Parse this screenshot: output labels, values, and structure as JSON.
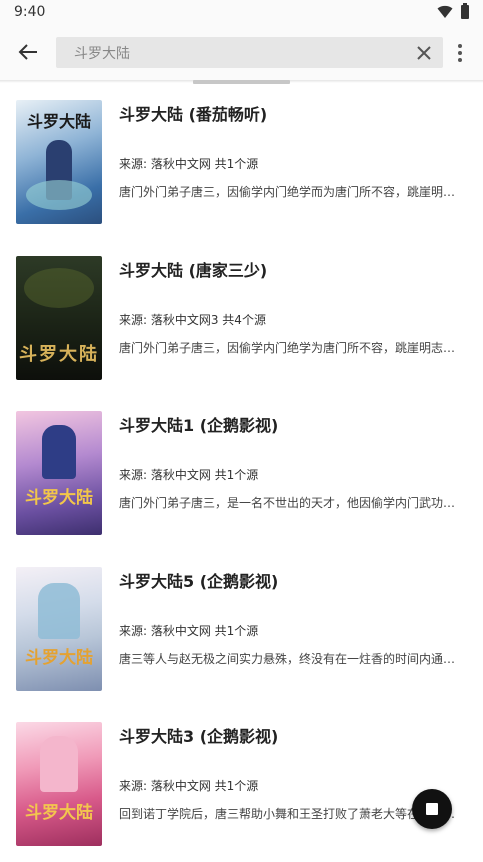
{
  "status_bar": {
    "time": "9:40"
  },
  "toolbar": {
    "search_value": "斗罗大陆",
    "back_icon": "arrow-left-icon",
    "clear_icon": "close-icon",
    "more_icon": "more-vert-icon"
  },
  "books": [
    {
      "title": "斗罗大陆 (番茄畅听)",
      "source": "来源: 落秋中文网  共1个源",
      "intro": "唐门外门弟子唐三，因偷学内门绝学而为唐门所不容，跳崖明志时却发现没有死，反而重生在另一个世界",
      "cover_text": "斗罗大陆"
    },
    {
      "title": "斗罗大陆 (唐家三少)",
      "source": "来源: 落秋中文网3  共4个源",
      "intro": "唐门外门弟子唐三，因偷学内门绝学为唐门所不容，跳崖明志时却发现没有死，反而附身在另一个世界",
      "cover_text": "斗罗大陆"
    },
    {
      "title": "斗罗大陆1 (企鹅影视)",
      "source": "来源: 落秋中文网  共1个源",
      "intro": "唐门外门弟子唐三，是一名不世出的天才，他因偷学内门武功心法而被唐门所不容",
      "cover_text": "斗罗大陆"
    },
    {
      "title": "斗罗大陆5 (企鹅影视)",
      "source": "来源: 落秋中文网  共1个源",
      "intro": "唐三等人与赵无极之间实力悬殊，终没有在一炷香的时间内通过考核",
      "cover_text": "斗罗大陆"
    },
    {
      "title": "斗罗大陆3 (企鹅影视)",
      "source": "来源: 落秋中文网  共1个源",
      "intro": "回到诺丁学院后，唐三帮助小舞和王圣打败了萧老大等在诺丁学院作威作福的人",
      "cover_text": "斗罗大陆"
    }
  ],
  "fab": {
    "icon": "stop-icon"
  },
  "colors": {
    "cover_1": "#3a6fa8",
    "cover_2": "#1e2a1c",
    "cover_3": "#6a4fa0",
    "cover_4": "#b8c6d8",
    "cover_5": "#d85a8a"
  }
}
